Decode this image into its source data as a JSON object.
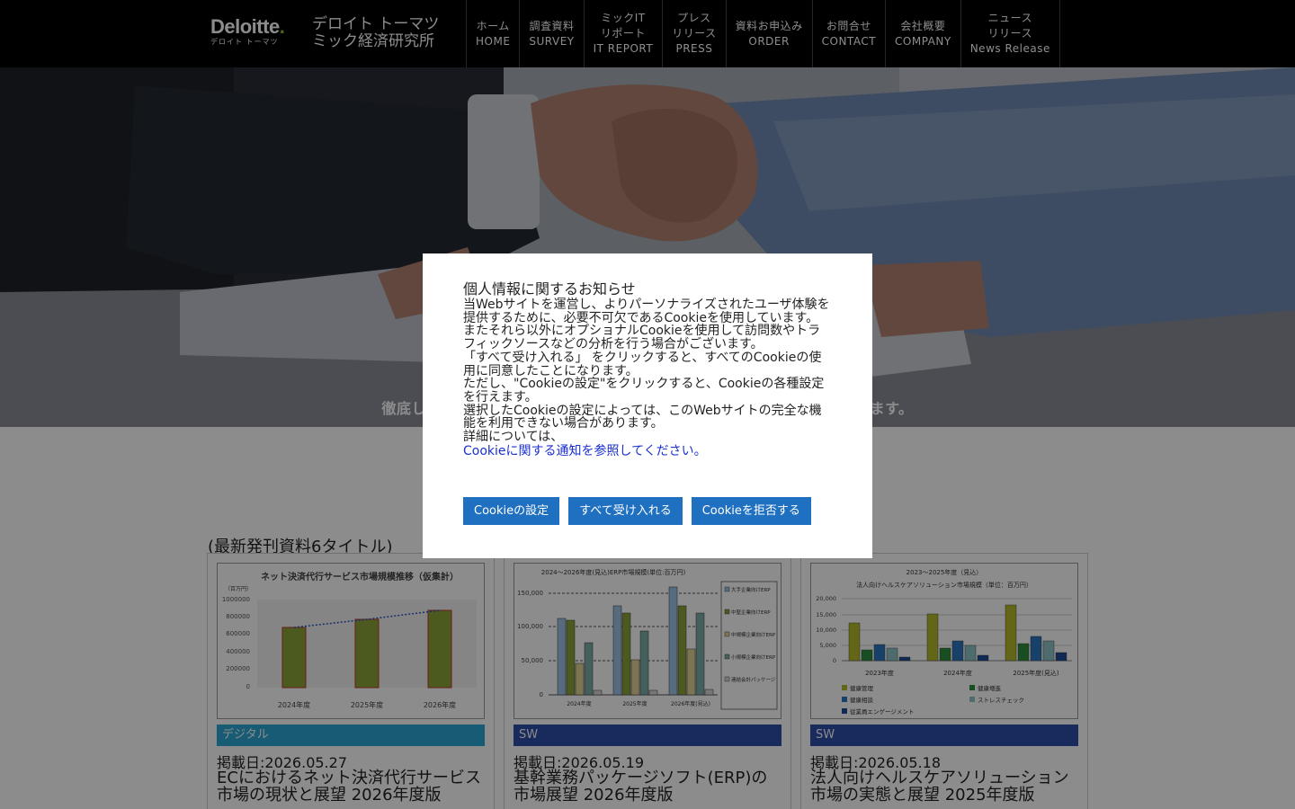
{
  "header": {
    "logo_word": "Deloitte",
    "logo_dot": ".",
    "logo_sub": "デロイト トーマツ",
    "company_name": "デロイト トーマツ\nミック経済研究所",
    "nav": [
      {
        "label": "ホーム\nHOME"
      },
      {
        "label": "調査資料\nSURVEY"
      },
      {
        "label": "ミックIT\nリポート\nIT REPORT"
      },
      {
        "label": "プレス\nリリース\nPRESS"
      },
      {
        "label": "資料お申込み\nORDER"
      },
      {
        "label": "お問合せ\nCONTACT"
      },
      {
        "label": "会社概要\nCOMPANY"
      },
      {
        "label": "ニュース\nリリース\nNews Release"
      }
    ]
  },
  "hero": {
    "tagline": "徹底した調査をベースに確度の高い市場データや資料を企画・制作しています。"
  },
  "latest": {
    "label": "(最新発刊資料6タイトル)",
    "cards": [
      {
        "category": "デジタル",
        "date": "掲載日:2026.05.27",
        "title": "ECにおけるネット決済代行サービス市場の現状と展望 2026年度版",
        "chart_title": "ネット決済代行サービス市場規模推移（仮集計）",
        "chart_unit": "（百万円）",
        "y_ticks": [
          "1000000",
          "800000",
          "600000",
          "400000",
          "200000",
          "0"
        ],
        "x_labels": [
          "2024年度",
          "2025年度",
          "2026年度"
        ]
      },
      {
        "category": "SW",
        "date": "掲載日:2026.05.19",
        "title": "基幹業務パッケージソフト(ERP)の市場展望 2026年度版",
        "chart_title": "2024～2026年度(見込)ERP市場規模(単位:百万円)",
        "y_ticks": [
          "150,000",
          "100,000",
          "50,000",
          "0"
        ],
        "x_labels": [
          "2024年度",
          "2025年度",
          "2026年度(見込)"
        ],
        "legend": [
          "大手企業向けERP",
          "中堅企業向けERP",
          "中規模企業向けERP",
          "小規模企業向けERP",
          "連結会計パッケージ"
        ]
      },
      {
        "category": "SW",
        "date": "掲載日:2026.05.18",
        "title": "法人向けヘルスケアソリューション市場の実態と展望 2025年度版",
        "chart_title_1": "2023～2025年度（見込）",
        "chart_title_2": "法人向けヘルスケアソリューション市場規模（単位：百万円）",
        "y_ticks": [
          "20,000",
          "15,000",
          "10,000",
          "5,000",
          "0"
        ],
        "x_labels": [
          "2023年度",
          "2024年度",
          "2025年度(見込)"
        ],
        "legend": [
          "健康管理",
          "健康増進",
          "健康相談",
          "ストレスチェック",
          "従業員エンゲージメント"
        ]
      }
    ]
  },
  "cookie_dialog": {
    "title": "個人情報に関するお知らせ",
    "paragraphs": [
      "当Webサイトを運営し、よりパーソナライズされたユーザ体験を提供するために、必要不可欠であるCookieを使用しています。",
      "またそれら以外にオプショナルCookieを使用して訪問数やトラフィックソースなどの分析を行う場合がございます。",
      "「すべて受け入れる」 をクリックすると、すべてのCookieの使用に同意したことになります。",
      "ただし、\"Cookieの設定\"をクリックすると、Cookieの各種設定を行えます。",
      "選択したCookieの設定によっては、このWebサイトの完全な機能を利用できない場合があります。",
      "詳細については、"
    ],
    "link": "Cookieに関する通知を参照してください。",
    "buttons": {
      "settings": "Cookieの設定",
      "accept_all": "すべて受け入れる",
      "reject": "Cookieを拒否する"
    }
  },
  "colors": {
    "header_bg": "#000000",
    "button_blue": "#1f70c1",
    "category_digital": "#2ba7d5",
    "category_sw": "#2f4ea8",
    "link_blue": "#1a2fd0"
  }
}
